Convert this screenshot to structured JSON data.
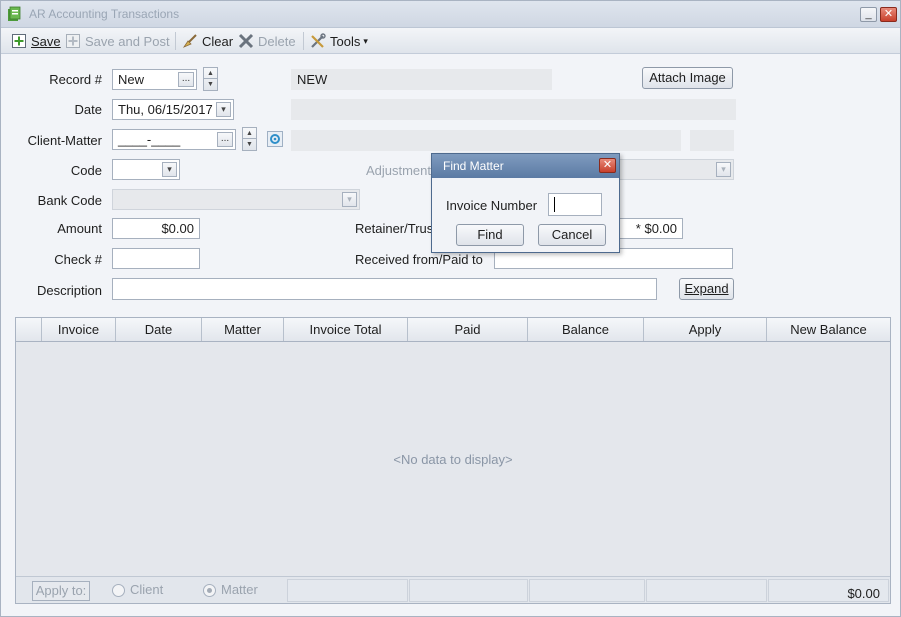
{
  "window": {
    "title": "AR Accounting Transactions",
    "minimize_label": "_",
    "close_label": "✕"
  },
  "toolbar": {
    "save": "Save",
    "save_and_post": "Save and Post",
    "clear": "Clear",
    "delete": "Delete",
    "tools": "Tools",
    "tools_arrow": "▾"
  },
  "form": {
    "record_label": "Record #",
    "record_value": "New",
    "record_status": "NEW",
    "attach_image": "Attach Image",
    "date_label": "Date",
    "date_value": "Thu, 06/15/2017",
    "client_matter_label": "Client-Matter",
    "client_matter_value": "____-____",
    "code_label": "Code",
    "adjustment_label": "Adjustment",
    "bank_code_label": "Bank Code",
    "amount_label": "Amount",
    "amount_value": "$0.00",
    "retainer_label": "Retainer/Trust",
    "retainer_value": "* $0.00",
    "check_label": "Check #",
    "received_label": "Received from/Paid to",
    "description_label": "Description",
    "expand": "Expand"
  },
  "grid": {
    "columns": [
      "Invoice",
      "Date",
      "Matter",
      "Invoice Total",
      "Paid",
      "Balance",
      "Apply",
      "New Balance"
    ],
    "empty_text": "<No data to display>",
    "apply_to": "Apply to:",
    "radio_client": "Client",
    "radio_matter": "Matter",
    "selected": "Matter",
    "total": "$0.00"
  },
  "dialog": {
    "title": "Find Matter",
    "close_label": "✕",
    "invoice_label": "Invoice Number",
    "invoice_value": "",
    "find": "Find",
    "cancel": "Cancel"
  },
  "icons": {
    "dropdown_arrow": "▾",
    "spin_up": "▲",
    "spin_down": "▼",
    "dots": "..."
  }
}
